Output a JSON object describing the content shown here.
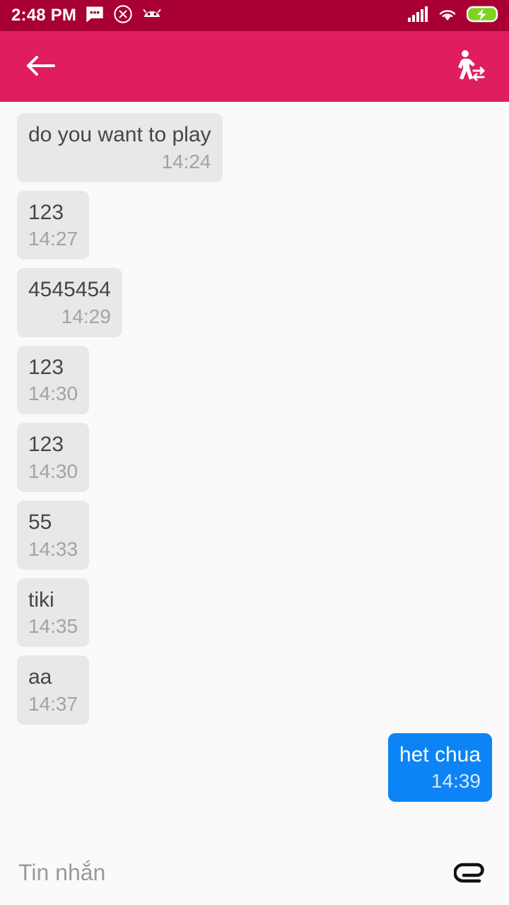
{
  "status_bar": {
    "clock": "2:48 PM",
    "background_color": "#a80034",
    "foreground_color": "#ffffff",
    "left_icons": [
      {
        "name": "sms-message-icon",
        "glyph": "message"
      },
      {
        "name": "close-circle-icon",
        "glyph": "x-circle"
      },
      {
        "name": "android-bug-icon",
        "glyph": "bug"
      }
    ],
    "right_icons": [
      {
        "name": "cellular-signal-icon",
        "glyph": "signal-bars"
      },
      {
        "name": "wifi-icon",
        "glyph": "wifi"
      },
      {
        "name": "battery-charging-icon",
        "glyph": "battery-bolt",
        "color": "#7ed321"
      }
    ]
  },
  "app_bar": {
    "background_color": "#e01e5f",
    "back_label": "Back",
    "action_label": "Transfer",
    "back_icon": "back-arrow-icon",
    "action_icon": "transfer-person-icon"
  },
  "chat": {
    "background_color": "#fafafa",
    "incoming_bubble_color": "#e8e8e8",
    "outgoing_bubble_color": "#0d84f5",
    "messages": [
      {
        "text": "do you want to play",
        "time": "14:24",
        "direction": "in"
      },
      {
        "text": "123",
        "time": "14:27",
        "direction": "in"
      },
      {
        "text": "4545454",
        "time": "14:29",
        "direction": "in"
      },
      {
        "text": "123",
        "time": "14:30",
        "direction": "in"
      },
      {
        "text": "123",
        "time": "14:30",
        "direction": "in"
      },
      {
        "text": "55",
        "time": "14:33",
        "direction": "in"
      },
      {
        "text": "tiki",
        "time": "14:35",
        "direction": "in"
      },
      {
        "text": "aa",
        "time": "14:37",
        "direction": "in"
      },
      {
        "text": "het chua",
        "time": "14:39",
        "direction": "out"
      }
    ]
  },
  "composer": {
    "placeholder": "Tin nhắn",
    "value": "",
    "attach_label": "Attach",
    "attach_icon": "paperclip-icon"
  }
}
